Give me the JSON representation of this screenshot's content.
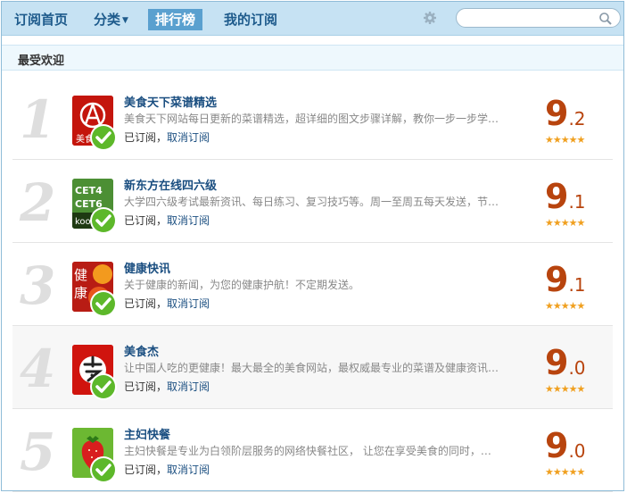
{
  "nav": {
    "home": "订阅首页",
    "category": "分类",
    "ranking": "排行榜",
    "mine": "我的订阅"
  },
  "search": {
    "placeholder": ""
  },
  "section": {
    "title": "最受欢迎"
  },
  "items": [
    {
      "rank": "1",
      "title": "美食天下菜谱精选",
      "desc": "美食天下网站每日更新的菜谱精选，超详细的图文步骤详解，教你一步一步学…",
      "subscribed": "已订阅",
      "unsubscribe": "取消订阅",
      "score_int": "9",
      "score_dec": ".2",
      "stars": "★★★★★"
    },
    {
      "rank": "2",
      "title": "新东方在线四六级",
      "desc": "大学四六级考试最新资讯、每日练习、复习技巧等。周一至周五每天发送，节…",
      "subscribed": "已订阅",
      "unsubscribe": "取消订阅",
      "score_int": "9",
      "score_dec": ".1",
      "stars": "★★★★★",
      "thumb_text": [
        "CET4",
        "CET6",
        "koo"
      ]
    },
    {
      "rank": "3",
      "title": "健康快讯",
      "desc": "关于健康的新闻，为您的健康护航！不定期发送。",
      "subscribed": "已订阅",
      "unsubscribe": "取消订阅",
      "score_int": "9",
      "score_dec": ".1",
      "stars": "★★★★★",
      "thumb_text": [
        "健",
        "康"
      ]
    },
    {
      "rank": "4",
      "title": "美食杰",
      "desc": "让中国人吃的更健康！最大最全的美食网站，最权威最专业的菜谱及健康资讯…",
      "subscribed": "已订阅",
      "unsubscribe": "取消订阅",
      "score_int": "9",
      "score_dec": ".0",
      "stars": "★★★★★"
    },
    {
      "rank": "5",
      "title": "主妇快餐",
      "desc": "主妇快餐是专业为白领阶层服务的网络快餐社区， 让您在享受美食的同时，也…",
      "subscribed": "已订阅",
      "unsubscribe": "取消订阅",
      "score_int": "9",
      "score_dec": ".0",
      "stars": "★★★★★"
    }
  ],
  "thumb1_text": "美食",
  "colors": {
    "nav_bg": "#c6e2f3",
    "active_tab": "#5aa0cf",
    "score": "#b8440e",
    "star": "#f0a020",
    "link": "#1a4e80"
  }
}
